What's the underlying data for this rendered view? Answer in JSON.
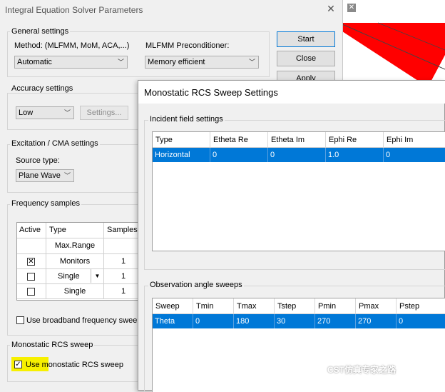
{
  "main_dialog": {
    "title": "Integral Equation Solver Parameters",
    "close_glyph": "✕",
    "buttons": {
      "start": "Start",
      "close": "Close",
      "apply": "Apply"
    },
    "general": {
      "title": "General settings",
      "method_label": "Method: (MLFMM, MoM, ACA,...)",
      "method_value": "Automatic",
      "precond_label": "MLFMM Preconditioner:",
      "precond_value": "Memory efficient"
    },
    "accuracy": {
      "title": "Accuracy settings",
      "value": "Low",
      "settings_button": "Settings..."
    },
    "excitation": {
      "title": "Excitation / CMA settings",
      "source_label": "Source type:",
      "source_value": "Plane Wave"
    },
    "frequency": {
      "title": "Frequency samples",
      "headers": [
        "Active",
        "Type",
        "Samples"
      ],
      "subheader": "Max.Range",
      "rows": [
        {
          "active": true,
          "type": "Monitors",
          "samples": "1"
        },
        {
          "active": false,
          "type": "Single",
          "samples": "1"
        },
        {
          "active": false,
          "type": "Single",
          "samples": "1"
        }
      ],
      "broadband_label": "Use broadband frequency sweep"
    },
    "monostatic": {
      "title": "Monostatic RCS sweep",
      "checkbox_label": "Use monostatic RCS sweep",
      "checked": true
    }
  },
  "sub_dialog": {
    "title": "Monostatic RCS Sweep Settings",
    "incident": {
      "title": "Incident field settings",
      "headers": [
        "Type",
        "Etheta Re",
        "Etheta Im",
        "Ephi Re",
        "Ephi Im"
      ],
      "rows": [
        [
          "Horizontal",
          "0",
          "0",
          "1.0",
          "0"
        ]
      ]
    },
    "observation": {
      "title": "Observation angle sweeps",
      "headers": [
        "Sweep",
        "Tmin",
        "Tmax",
        "Tstep",
        "Pmin",
        "Pmax",
        "Pstep"
      ],
      "rows": [
        [
          "Theta",
          "0",
          "180",
          "30",
          "270",
          "270",
          "0"
        ]
      ]
    }
  },
  "background_app": {
    "close_glyph": "✕",
    "accent_color": "#ff0000"
  },
  "watermark": "CST仿真专家之路",
  "colors": {
    "selection": "#0078d7",
    "highlight": "#f7f000"
  }
}
